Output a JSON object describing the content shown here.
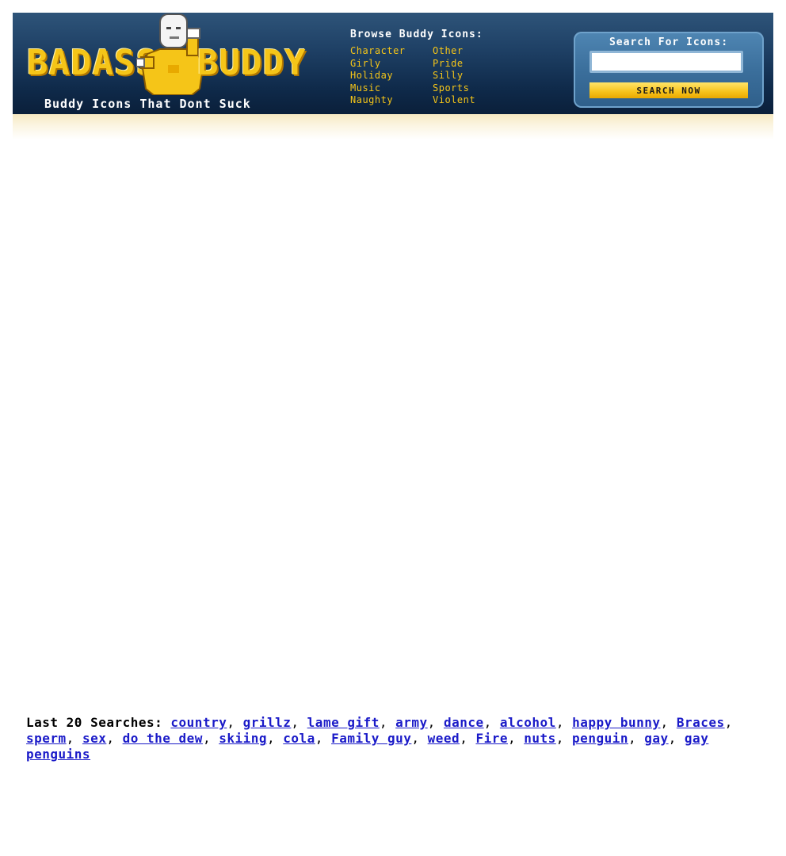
{
  "logo": {
    "word_left": "BADASS",
    "word_right": "BUDDY"
  },
  "header": {
    "tagline": "Buddy Icons That Dont Suck"
  },
  "browse": {
    "title": "Browse Buddy Icons:",
    "categories": [
      "Character",
      "Other",
      "Girly",
      "Pride",
      "Holiday",
      "Silly",
      "Music",
      "Sports",
      "Naughty",
      "Violent"
    ]
  },
  "search": {
    "title": "Search For Icons:",
    "input_value": "",
    "button_label": "SEARCH NOW"
  },
  "last_searches": {
    "label": "Last 20 Searches:",
    "terms": [
      "country",
      "grillz",
      "lame gift",
      "army",
      "dance",
      "alcohol",
      "happy bunny",
      "Braces",
      "sperm",
      "sex",
      "do the dew",
      "skiing",
      "cola",
      "Family guy",
      "weed",
      "Fire",
      "nuts",
      "penguin",
      "gay",
      "gay penguins"
    ]
  },
  "colors": {
    "accent": "#f5c518",
    "header_bg": "#1f4166",
    "link": "#1a1ac8"
  }
}
